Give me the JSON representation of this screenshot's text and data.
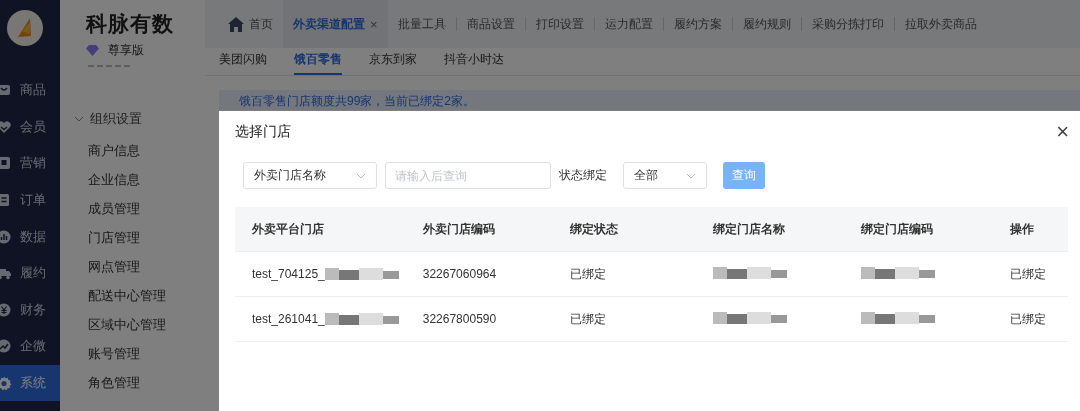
{
  "nav_rail": {
    "items": [
      {
        "label": "商品",
        "selected": false
      },
      {
        "label": "会员",
        "selected": false
      },
      {
        "label": "营销",
        "selected": false
      },
      {
        "label": "订单",
        "selected": false
      },
      {
        "label": "数据",
        "selected": false
      },
      {
        "label": "履约",
        "selected": false
      },
      {
        "label": "财务",
        "selected": false
      },
      {
        "label": "企微",
        "selected": false
      },
      {
        "label": "系统",
        "selected": true
      }
    ]
  },
  "brand": {
    "title": "科脉有数",
    "edition": "尊享版"
  },
  "menu": {
    "groups": [
      {
        "label": "组织设置",
        "expanded": true,
        "children": [
          {
            "label": "商户信息",
            "selected": false
          },
          {
            "label": "企业信息",
            "selected": false
          },
          {
            "label": "成员管理",
            "selected": false
          },
          {
            "label": "门店管理",
            "selected": false
          },
          {
            "label": "网点管理",
            "selected": false
          },
          {
            "label": "配送中心管理",
            "selected": false
          },
          {
            "label": "区域中心管理",
            "selected": false
          },
          {
            "label": "账号管理",
            "selected": false
          },
          {
            "label": "角色管理",
            "selected": false
          }
        ]
      }
    ]
  },
  "page_tabs": [
    {
      "label": "首页",
      "kind": "home",
      "selected": false
    },
    {
      "label": "外卖渠道配置",
      "kind": "closable",
      "close": "×",
      "selected": true
    },
    {
      "label": "批量工具",
      "kind": "plain",
      "selected": false
    },
    {
      "label": "商品设置",
      "kind": "plain",
      "selected": false
    },
    {
      "label": "打印设置",
      "kind": "plain",
      "selected": false
    },
    {
      "label": "运力配置",
      "kind": "plain",
      "selected": false
    },
    {
      "label": "履约方案",
      "kind": "plain",
      "selected": false
    },
    {
      "label": "履约规则",
      "kind": "plain",
      "selected": false
    },
    {
      "label": "采购分拣打印",
      "kind": "plain",
      "selected": false
    },
    {
      "label": "拉取外卖商品",
      "kind": "plain",
      "selected": false
    }
  ],
  "channel_tabs": [
    {
      "label": "美团闪购",
      "selected": false
    },
    {
      "label": "饿百零售",
      "selected": true
    },
    {
      "label": "京东到家",
      "selected": false
    },
    {
      "label": "抖音小时达",
      "selected": false
    }
  ],
  "notice": "饿百零售门店额度共99家，当前已绑定2家。",
  "dialog": {
    "title": "选择门店",
    "close": "×",
    "filters": {
      "field_select": "外卖门店名称",
      "keyword_placeholder": "请输入后查询",
      "status_label": "状态绑定",
      "status_select": "全部",
      "query_button": "查询"
    },
    "table": {
      "columns": [
        "外卖平台门店",
        "外卖门店编码",
        "绑定状态",
        "绑定门店名称",
        "绑定门店编码",
        "操作"
      ],
      "rows": [
        {
          "cells": [
            {
              "text": "test_704125_",
              "redacted": true
            },
            {
              "text": "32267060964",
              "redacted": false
            },
            {
              "text": "已绑定",
              "redacted": false
            },
            {
              "redacted": true
            },
            {
              "redacted": true
            },
            {
              "text": "已绑定",
              "redacted": false
            }
          ]
        },
        {
          "cells": [
            {
              "text": "test_261041_",
              "redacted": true
            },
            {
              "text": "32267800590",
              "redacted": false
            },
            {
              "text": "已绑定",
              "redacted": false
            },
            {
              "redacted": true
            },
            {
              "redacted": true
            },
            {
              "text": "已绑定",
              "redacted": false
            }
          ]
        }
      ]
    }
  }
}
